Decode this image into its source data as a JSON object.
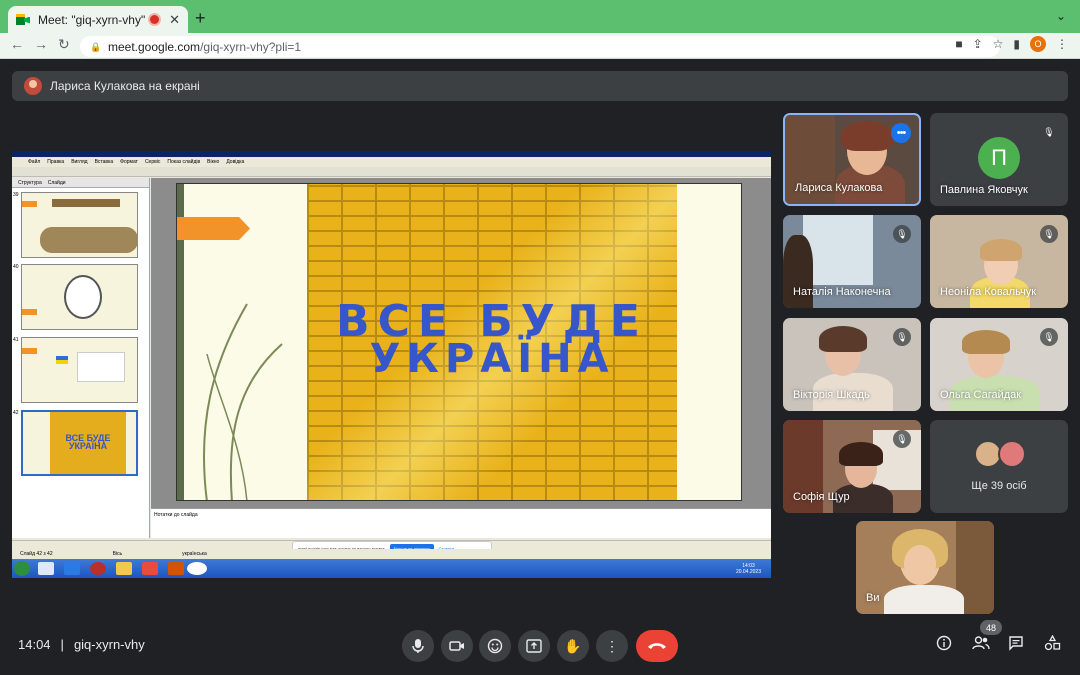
{
  "browser": {
    "tab_title": "Meet: \"giq-xyrn-vhy\"",
    "tab_close": "✕",
    "new_tab": "+",
    "tab_menu": "⌄",
    "url_host": "meet.google.com",
    "url_path": "/giq-xyrn-vhy?pli=1",
    "profile_initial": "O"
  },
  "banner": {
    "text": "Лариса Кулакова на екрані"
  },
  "shared_screen": {
    "app_title": "Microsoft PowerPoint - [Презентація1]",
    "menu": [
      "Файл",
      "Правка",
      "Вигляд",
      "Вставка",
      "Формат",
      "Сервіс",
      "Показ слайдів",
      "Вікно",
      "Довідка"
    ],
    "panel_tabs": [
      "Структура",
      "Слайди"
    ],
    "thumb_numbers": [
      "39",
      "40",
      "41",
      "42"
    ],
    "slide_text_line1": "ВСЕ БУДЕ",
    "slide_text_line2": "УКРАЇНА",
    "notes_placeholder": "Нотатки до слайда",
    "status_slide": "Слайд 42 з 42",
    "status_theme": "Вісь",
    "status_lang": "українська",
    "share_notice": "meet.google.com має доступ до вашого екрана",
    "share_stop": "Більше не ділитися",
    "share_hide": "Сховати",
    "clock_time": "14:03",
    "clock_date": "20.04.2023"
  },
  "participants": [
    {
      "name": "Лариса Кулакова",
      "muted": false,
      "active": true
    },
    {
      "name": "Павлина Яковчук",
      "muted": true,
      "initial": "П"
    },
    {
      "name": "Наталія Наконечна",
      "muted": true
    },
    {
      "name": "Неоніла Ковальчук",
      "muted": true
    },
    {
      "name": "Вікторія Шкадь",
      "muted": true
    },
    {
      "name": "Ольга Сагайдак",
      "muted": true
    },
    {
      "name": "Софія Щур",
      "muted": true
    },
    {
      "name": "Ще 39 осіб",
      "muted": false
    },
    {
      "name": "Ви",
      "muted": false
    }
  ],
  "bottom": {
    "time": "14:04",
    "separator": "|",
    "meeting_code": "giq-xyrn-vhy",
    "people_count": "48"
  },
  "colors": {
    "tabbar": "#5bbf6f",
    "end_call": "#ea4335",
    "avatar_green": "#4caf50",
    "active_border": "#8ab4f8",
    "slide_wall": "#e9b21a",
    "slide_text": "#3656c9"
  },
  "icons": [
    "meet-favicon",
    "recording-icon",
    "back-icon",
    "forward-icon",
    "reload-icon",
    "lock-icon",
    "camera-icon",
    "share-icon",
    "bookmark-star-icon",
    "sidebar-icon",
    "mic-off-icon",
    "mic-icon",
    "camera-icon",
    "emoji-icon",
    "present-icon",
    "raise-hand-icon",
    "more-vert-icon",
    "end-call-icon",
    "info-icon",
    "people-icon",
    "chat-icon",
    "activities-icon"
  ]
}
